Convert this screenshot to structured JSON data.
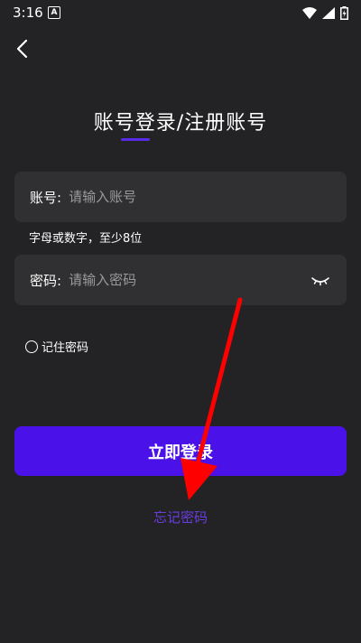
{
  "status_bar": {
    "time": "3:16",
    "notification_icon": "A"
  },
  "header": {
    "title": "账号登录/注册账号"
  },
  "account": {
    "label": "账号:",
    "placeholder": "请输入账号",
    "hint": "字母或数字，至少8位"
  },
  "password": {
    "label": "密码:",
    "placeholder": "请输入密码"
  },
  "remember": {
    "label": "记住密码"
  },
  "login_button": {
    "label": "立即登录"
  },
  "forgot_link": {
    "label": "忘记密码"
  },
  "colors": {
    "background": "#232325",
    "field_bg": "#303032",
    "accent": "#4a12e8",
    "link": "#6a3ce0",
    "annotation": "#ff0000"
  }
}
